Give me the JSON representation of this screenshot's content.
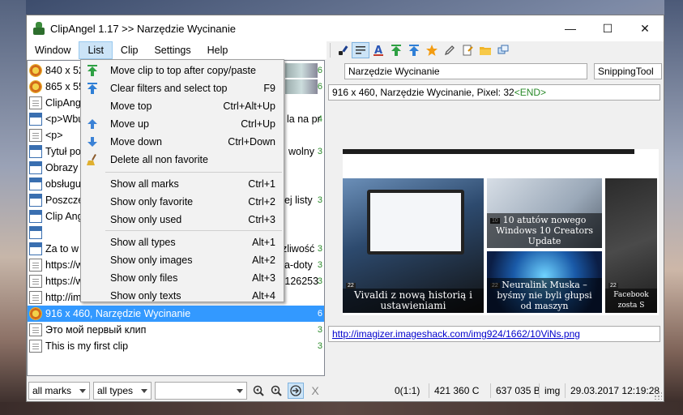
{
  "window": {
    "title": "ClipAngel 1.17 >> Narzędzie Wycinanie",
    "minimize_glyph": "—",
    "maximize_glyph": "☐",
    "close_glyph": "✕"
  },
  "menu": {
    "items": [
      "Window",
      "List",
      "Clip",
      "Settings",
      "Help"
    ],
    "active": "List"
  },
  "list_menu": [
    {
      "label": "Move clip to top after copy/paste",
      "shortcut": "",
      "icon": "arrow-up-green-icon"
    },
    {
      "label": "Clear filters and select top",
      "shortcut": "F9",
      "icon": "arrow-up-blue-icon"
    },
    {
      "label": "Move top",
      "shortcut": "Ctrl+Alt+Up",
      "icon": ""
    },
    {
      "label": "Move up",
      "shortcut": "Ctrl+Up",
      "icon": "arrow-up-icon"
    },
    {
      "label": "Move down",
      "shortcut": "Ctrl+Down",
      "icon": "arrow-down-icon"
    },
    {
      "label": "Delete all non favorite",
      "shortcut": "",
      "icon": "broom-icon"
    },
    {
      "label": "Show all marks",
      "shortcut": "Ctrl+1",
      "icon": ""
    },
    {
      "label": "Show only favorite",
      "shortcut": "Ctrl+2",
      "icon": ""
    },
    {
      "label": "Show only used",
      "shortcut": "Ctrl+3",
      "icon": ""
    },
    {
      "label": "Show all types",
      "shortcut": "Alt+1",
      "icon": ""
    },
    {
      "label": "Show only images",
      "shortcut": "Alt+2",
      "icon": ""
    },
    {
      "label": "Show only files",
      "shortcut": "Alt+3",
      "icon": ""
    },
    {
      "label": "Show only texts",
      "shortcut": "Alt+4",
      "icon": ""
    }
  ],
  "clips": [
    {
      "type": "img",
      "text": "840 x 526",
      "num": "6"
    },
    {
      "type": "img",
      "text": "865 x 550",
      "num": "6"
    },
    {
      "type": "doc",
      "text": "ClipAngel",
      "num": ""
    },
    {
      "type": "html",
      "text": "<p>Wbu",
      "tail": "la na pr",
      "num": "4"
    },
    {
      "type": "doc",
      "text": "<p>",
      "num": ""
    },
    {
      "type": "html",
      "text": "Tytuł pos",
      "tail": "wolny",
      "num": "3"
    },
    {
      "type": "html",
      "text": "Obrazy n",
      "num": ""
    },
    {
      "type": "html",
      "text": "obsługuj",
      "num": ""
    },
    {
      "type": "html",
      "text": "Poszczeg",
      "tail": "nej listy",
      "num": "3"
    },
    {
      "type": "html",
      "text": "Clip Ang",
      "num": ""
    },
    {
      "type": "html",
      "text": "",
      "num": ""
    },
    {
      "type": "html",
      "text": "Za to w s",
      "tail": "zliwość",
      "num": "3"
    },
    {
      "type": "doc",
      "text": "https://w",
      "tail": "na-doty",
      "num": "3"
    },
    {
      "type": "doc",
      "text": "https://w",
      "tail": "na.126253",
      "num": "3"
    },
    {
      "type": "doc",
      "text": "http://im",
      "num": ""
    },
    {
      "type": "img",
      "text": "916 x 460, Narzędzie Wycinanie",
      "num": "6",
      "selected": true
    },
    {
      "type": "doc",
      "text": "Это мой первый клип",
      "num": "3"
    },
    {
      "type": "doc",
      "text": "This is my first clip",
      "num": "3"
    }
  ],
  "detail": {
    "title_value": "Narzędzie Wycinanie",
    "app_value": "SnippingTool",
    "info": "916 x 460, Narzędzie Wycinanie, Pixel: 32",
    "info_end": "<END>",
    "url": "http://imagizer.imageshack.com/img924/1662/10ViNs.png"
  },
  "preview": {
    "tiles": [
      {
        "caption": "Vivaldi z nową historią i ustawieniami",
        "badge": "22"
      },
      {
        "caption": "10 atutów nowego Windows 10 Creators Update",
        "badge": "10"
      },
      {
        "caption": "Neuralink Muska – byśmy nie byli głupsi od maszyn",
        "badge": "22"
      },
      {
        "caption": "Facebook zosta S",
        "badge": "22"
      }
    ]
  },
  "bottom": {
    "marks_filter": "all marks",
    "types_filter": "all types",
    "search_value": "",
    "clear_glyph": "X",
    "status": [
      "0(1:1)",
      "421 360 C",
      "637 035 B",
      "img",
      "29.03.2017 12:19:28"
    ]
  },
  "colors": {
    "selection": "#3399ff",
    "menu_highlight": "#cce4f7",
    "end_marker": "#2a8a2a",
    "link": "#0000cc"
  }
}
